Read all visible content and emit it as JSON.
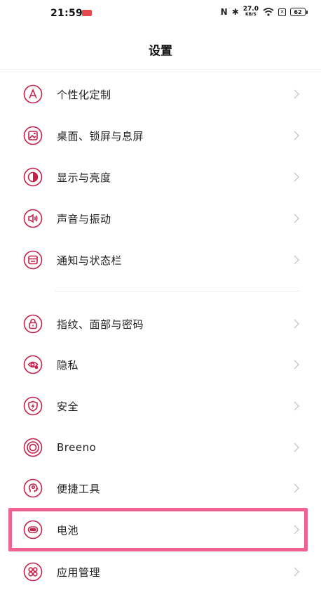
{
  "status_bar": {
    "time": "21:59",
    "net_speed_value": "27.0",
    "net_speed_unit": "KB/S",
    "battery_level": "62"
  },
  "header": {
    "title": "设置"
  },
  "settings": {
    "group1": [
      {
        "label": "个性化定制",
        "icon": "personalize-icon"
      },
      {
        "label": "桌面、锁屏与息屏",
        "icon": "wallpaper-icon"
      },
      {
        "label": "显示与亮度",
        "icon": "brightness-icon"
      },
      {
        "label": "声音与振动",
        "icon": "speaker-icon"
      },
      {
        "label": "通知与状态栏",
        "icon": "notification-icon"
      }
    ],
    "group2": [
      {
        "label": "指纹、面部与密码",
        "icon": "lock-icon"
      },
      {
        "label": "隐私",
        "icon": "privacy-eye-icon"
      },
      {
        "label": "安全",
        "icon": "security-shield-icon"
      },
      {
        "label": "Breeno",
        "icon": "breeno-icon"
      },
      {
        "label": "便捷工具",
        "icon": "tools-icon"
      },
      {
        "label": "电池",
        "icon": "battery-icon"
      },
      {
        "label": "应用管理",
        "icon": "apps-icon"
      }
    ]
  },
  "colors": {
    "accent": "#c6214b",
    "highlight": "#f06292"
  }
}
